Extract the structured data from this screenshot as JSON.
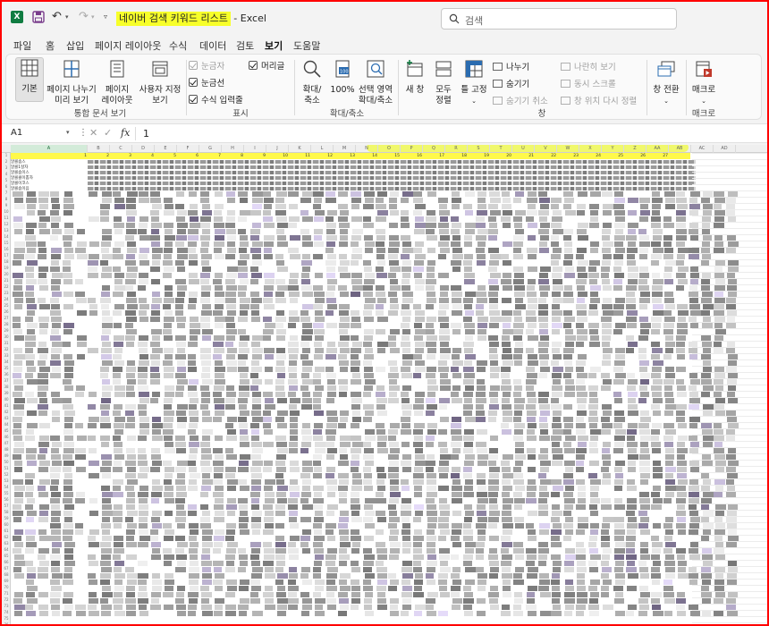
{
  "window": {
    "doc_name": "네이버 검색 키워드 리스트",
    "title_suffix": " - Excel",
    "search_placeholder": "검색"
  },
  "qat": {
    "app_icon": "excel-icon",
    "save_icon": "save-icon",
    "undo_icon": "undo-icon",
    "redo_icon": "redo-icon",
    "customize_icon": "customize-qat-icon"
  },
  "menu": {
    "tabs": [
      "파일",
      "홈",
      "삽입",
      "페이지 레이아웃",
      "수식",
      "데이터",
      "검토",
      "보기",
      "도움말"
    ],
    "active": "보기"
  },
  "ribbon": {
    "workbook_views": {
      "label": "통합 문서 보기",
      "normal": "기본",
      "page_break_1": "페이지 나누기",
      "page_break_2": "미리 보기",
      "page_layout_1": "페이지",
      "page_layout_2": "레이아웃",
      "custom_1": "사용자 지정",
      "custom_2": "보기"
    },
    "show": {
      "label": "표시",
      "ruler": "눈금자",
      "gridlines": "눈금선",
      "formula_bar": "수식 입력줄",
      "headings": "머리글"
    },
    "zoom": {
      "label": "확대/축소",
      "zoom_1": "확대/",
      "zoom_2": "축소",
      "hundred": "100%",
      "selection_1": "선택 영역",
      "selection_2": "확대/축소"
    },
    "window": {
      "label": "창",
      "new_window": "새 창",
      "arrange_1": "모두",
      "arrange_2": "정렬",
      "freeze": "틀 고정",
      "split": "나누기",
      "hide": "숨기기",
      "unhide": "숨기기 취소",
      "side_by_side": "나란히 보기",
      "sync_scroll": "동시 스크롤",
      "reset_position": "창 위치 다시 정렬",
      "switch": "창 전환"
    },
    "macros": {
      "label": "매크로",
      "macros": "매크로"
    }
  },
  "formula_bar": {
    "name_box": "A1",
    "value": "1"
  },
  "sheet": {
    "column_letters": [
      "A",
      "B",
      "C",
      "D",
      "E",
      "F",
      "G",
      "H",
      "I",
      "J",
      "K",
      "L",
      "M",
      "N",
      "O",
      "P",
      "Q",
      "R",
      "S",
      "T",
      "U",
      "V",
      "W",
      "X",
      "Y",
      "Z",
      "AA",
      "AB",
      "AC",
      "AD"
    ],
    "row1_values": [
      "1",
      "2",
      "3",
      "4",
      "5",
      "6",
      "7",
      "8",
      "9",
      "10",
      "11",
      "12",
      "13",
      "14",
      "15",
      "16",
      "17",
      "18",
      "19",
      "20",
      "21",
      "22",
      "23",
      "24",
      "25",
      "26",
      "27"
    ],
    "visible_rows": [
      "알콜솜스",
      "알콜1살자",
      "알콜솜이스",
      "알콜콜이뽑자",
      "알콜이코스",
      "알콜솜이음"
    ],
    "accent_color": "#107c41",
    "highlight_color": "#f7ff2a"
  }
}
